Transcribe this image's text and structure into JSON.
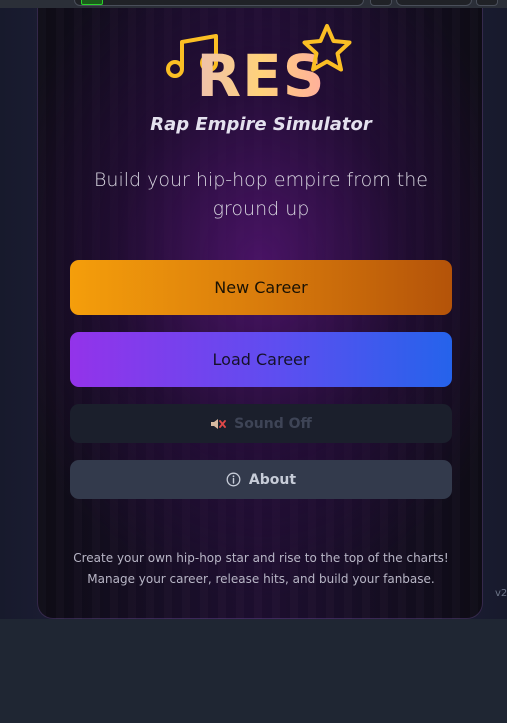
{
  "app": {
    "logo": "RES",
    "subtitle": "Rap Empire Simulator",
    "tagline": "Build your hip-hop empire from the ground up"
  },
  "buttons": {
    "new_career": "New Career",
    "load_career": "Load Career",
    "sound": "Sound Off",
    "about": "About"
  },
  "icons": {
    "logo_left": "music-note-icon",
    "logo_right": "star-icon",
    "sound": "speaker-muted-icon",
    "about": "info-icon"
  },
  "footer": {
    "line1": "Create your own hip-hop star and rise to the top of the charts!",
    "line2": "Manage your career, release hits, and build your fanbase."
  },
  "version": "v2",
  "colors": {
    "new_career_start": "#f59e0b",
    "new_career_end": "#b45309",
    "load_career_start": "#9333ea",
    "load_career_end": "#2563eb",
    "logo_gold": "#fbbf24"
  }
}
